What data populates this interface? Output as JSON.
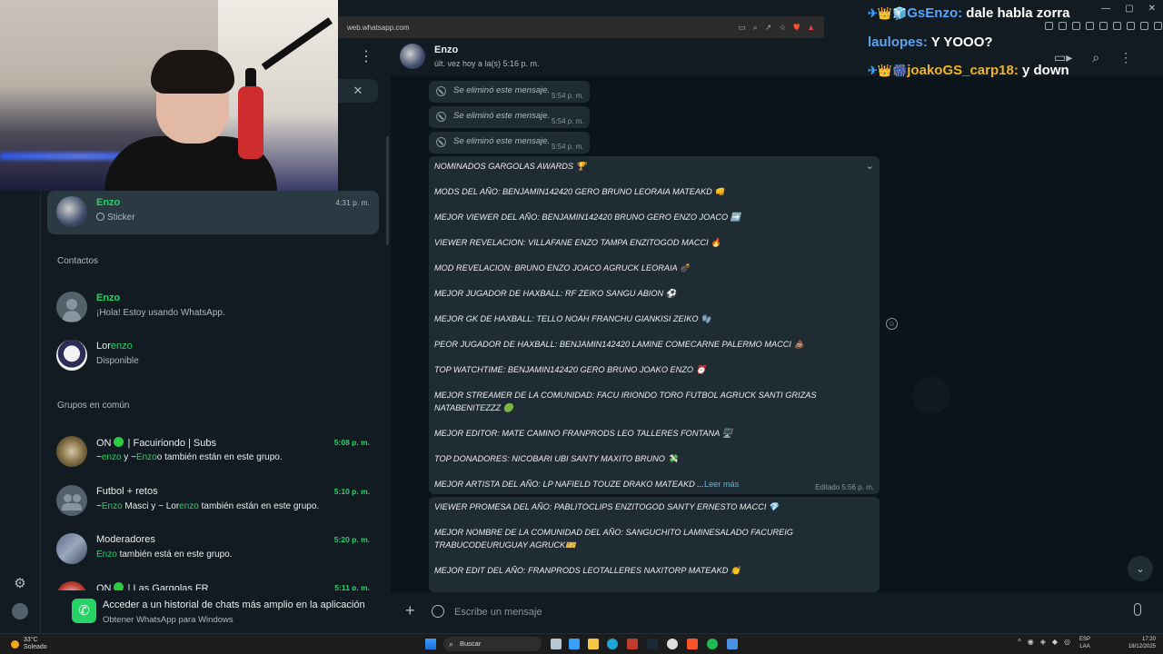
{
  "browser": {
    "url": "web.whatsapp.com"
  },
  "left": {
    "active_chat": {
      "name": "Enzo",
      "subtitle": "Sticker",
      "time": "4:31 p. m."
    },
    "contacts_header": "Contactos",
    "contacts": [
      {
        "name": "Enzo",
        "status": "¡Hola! Estoy usando WhatsApp."
      },
      {
        "name_a": "Lor",
        "name_b": "enzo",
        "status": "Disponible"
      }
    ],
    "groups_header": "Grupos en común",
    "groups": [
      {
        "name_a": "ON",
        "name_b": " | Facuiriondo | Subs",
        "time": "5:08 p. m.",
        "sub_a": "~",
        "sub_b": "enzo",
        "sub_c": " y ~",
        "sub_d": "Enzo",
        "sub_e": "o también están en este grupo."
      },
      {
        "name": "Futbol + retos",
        "time": "5:10 p. m.",
        "sub_a": "~",
        "sub_b": "Enzo",
        "sub_c": " Masci y ~ Lor",
        "sub_d": "enzo",
        "sub_e": " también están en este grupo."
      },
      {
        "name": "Moderadores",
        "time": "5:20 p. m.",
        "sub_a": "Enzo",
        "sub_b": " también está en este grupo."
      },
      {
        "name_a": "ON",
        "name_b": " | Las Gargolas FR",
        "time": "5:11 p. m."
      }
    ],
    "banner": {
      "title": "Acceder a un historial de chats más amplio en la aplicación",
      "subtitle": "Obtener WhatsApp para Windows"
    }
  },
  "chat": {
    "name": "Enzo",
    "status": "últ. vez hoy a la(s) 5:16 p. m.",
    "deleted": [
      {
        "text": "Se eliminó este mensaje.",
        "time": "5:54 p. m."
      },
      {
        "text": "Se eliminó este mensaje.",
        "time": "5:54 p. m."
      },
      {
        "text": "Se eliminó este mensaje.",
        "time": "5:54 p. m."
      }
    ],
    "message1": {
      "lines": [
        "NOMINADOS GARGOLAS AWARDS 🏆",
        "MODS DEL AÑO: BENJAMIN142420 GERO BRUNO LEORAIA MATEAKD 👊",
        "MEJOR VIEWER DEL AÑO: BENJAMIN142420 BRUNO GERO ENZO JOACO ➡️",
        "VIEWER REVELACION: VILLAFANE ENZO TAMPA ENZITOGOD MACCI 🔥",
        "MOD REVELACION: BRUNO ENZO JOACO AGRUCK LEORAIA 💣",
        "MEJOR JUGADOR DE HAXBALL: RF ZEIKO SANGU ABION ⚽",
        "MEJOR GK DE HAXBALL: TELLO NOAH FRANCHU GIANKISI ZEIKO 🧤",
        "PEOR JUGADOR DE HAXBALL: BENJAMIN142420 LAMINE COMECARNE PALERMO MACCI 💩",
        "TOP WATCHTIME: BENJAMIN142420 GERO BRUNO JOAKO ENZO ⏰",
        "MEJOR STREAMER DE LA COMUNIDAD: FACU IRIONDO TORO FUTBOL AGRUCK SANTI GRIZAS",
        "NATABENITEZZZ 🟢",
        "MEJOR EDITOR: MATE CAMINO FRANPRODS LEO TALLERES FONTANA 🖥️",
        "TOP DONADORES: NICOBARI UBI SANTY MAXITO BRUNO 💸",
        "MEJOR ARTISTA DEL AÑO: LP NAFIELD TOUZE DRAKO MATEAKD ..."
      ],
      "read_more": "Leer más",
      "edited": "Editado 5:56 p. m."
    },
    "message2": {
      "lines": [
        "VIEWER PROMESA DEL AÑO: PABLITOCLIPS ENZITOGOD SANTY ERNESTO MACCI 💎",
        "MEJOR NOMBRE DE LA COMUNIDAD DEL AÑO: SANGUCHITO LAMINESALADO FACUREIG",
        "TRABUCODEURUGUAY AGRUCK🎫",
        "MEJOR EDIT DEL AÑO: FRANPRODS LEOTALLERES NAXITORP MATEAKD 👏"
      ]
    },
    "compose_placeholder": "Escribe un mensaje"
  },
  "stream_chat": [
    {
      "user": "GsEnzo:",
      "msg": " dale habla zorra",
      "badges": "✈👑🧊"
    },
    {
      "user": "laulopes:",
      "msg": " Y YOOO?",
      "badges": ""
    },
    {
      "user": "joakoGS_carp18:",
      "msg": " y down",
      "badges": "✈👑🎆"
    }
  ],
  "taskbar": {
    "weather_temp": "33°C",
    "weather_text": "Soleado",
    "search": "Buscar",
    "lang_a": "ESP",
    "lang_b": "LAA",
    "time": "17:20",
    "date": "18/12/2025"
  },
  "colors": {
    "accent": "#25d366",
    "panel": "#111b21",
    "bubble": "#202c33"
  }
}
